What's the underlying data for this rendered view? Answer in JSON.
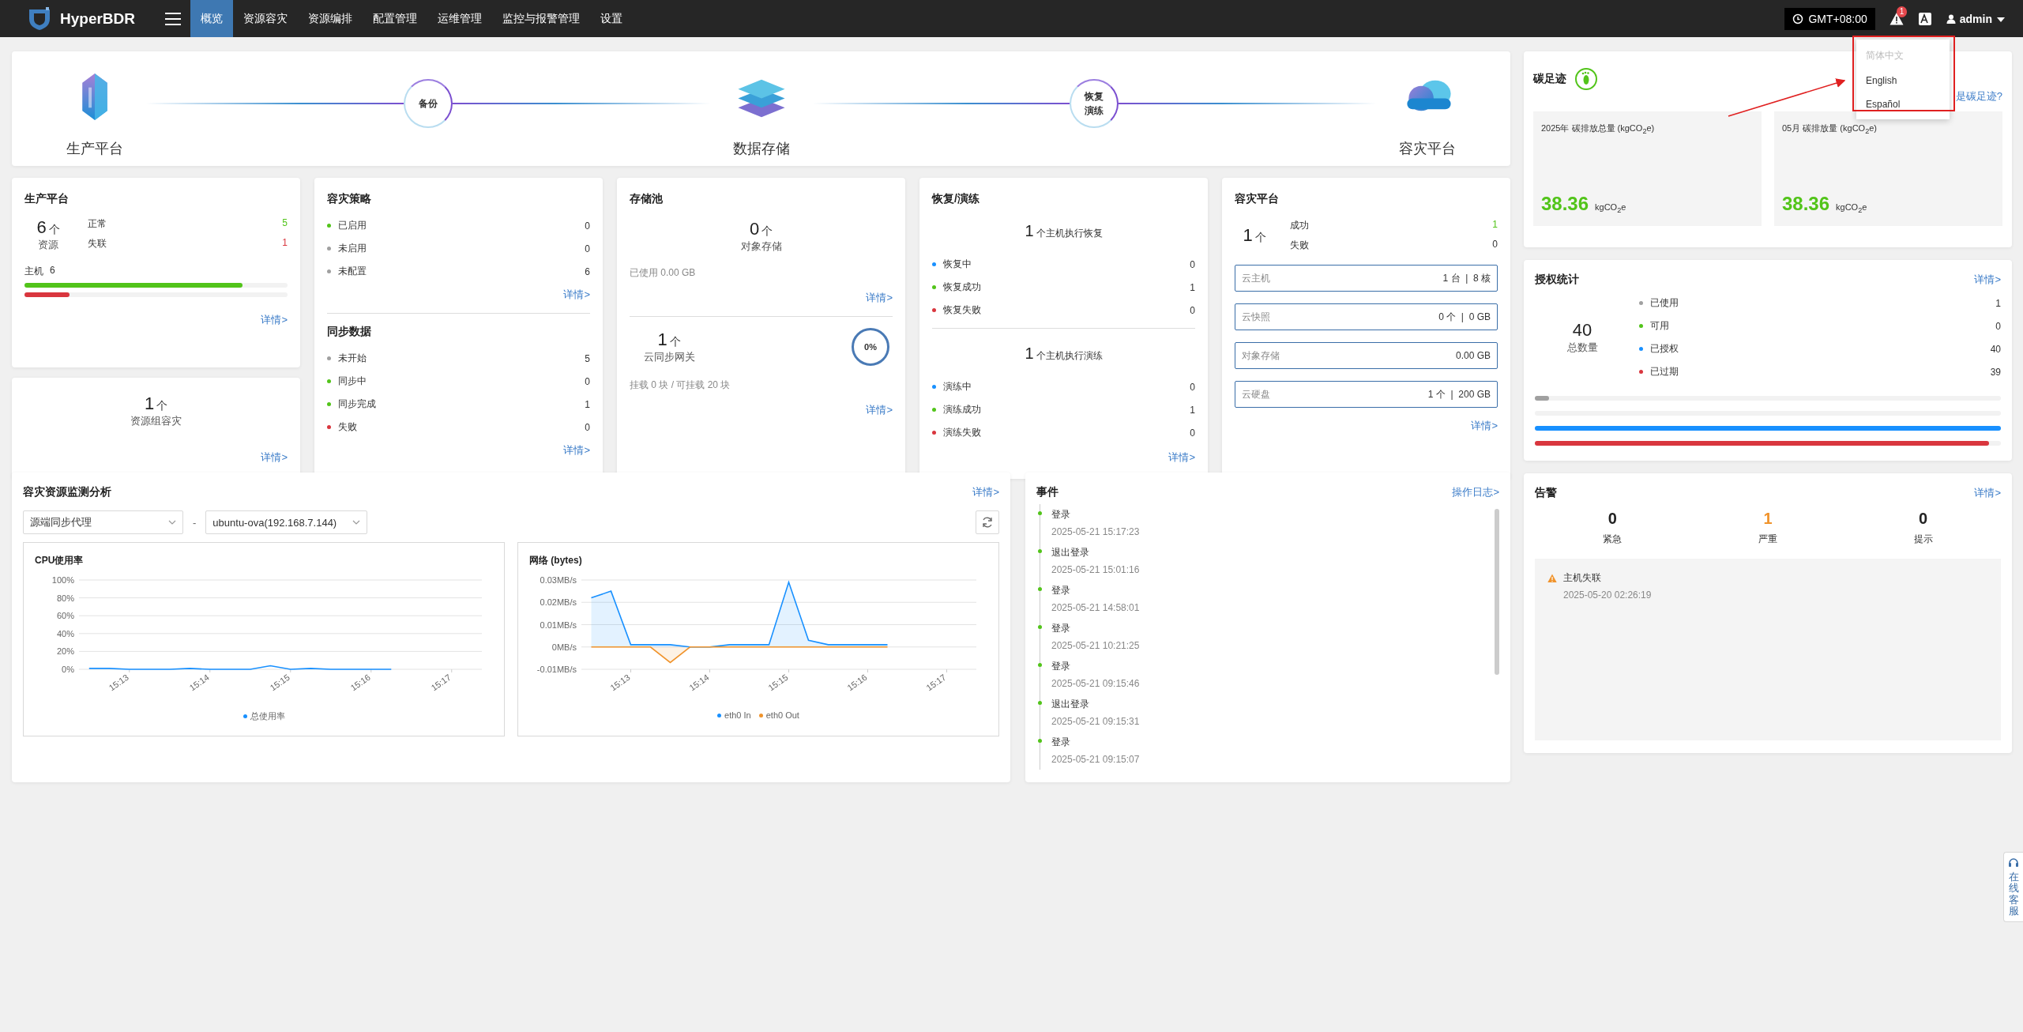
{
  "top_bar": {
    "brand": "HyperBDR",
    "nav": [
      {
        "label": "概览",
        "selected": true
      },
      {
        "label": "资源容灾",
        "selected": false
      },
      {
        "label": "资源编排",
        "selected": false
      },
      {
        "label": "配置管理",
        "selected": false
      },
      {
        "label": "运维管理",
        "selected": false
      },
      {
        "label": "监控与报警管理",
        "selected": false
      },
      {
        "label": "设置",
        "selected": false
      }
    ],
    "timezone": "GMT+08:00",
    "alert_count": "1",
    "user": "admin",
    "language_menu": [
      {
        "label": "简体中文",
        "disabled": true
      },
      {
        "label": "English",
        "disabled": false
      },
      {
        "label": "Español",
        "disabled": false
      }
    ]
  },
  "flow": {
    "stages": [
      {
        "kind": "production",
        "label": "生产平台"
      },
      {
        "kind": "storage",
        "label": "数据存储"
      },
      {
        "kind": "dr",
        "label": "容灾平台"
      }
    ],
    "steps": [
      {
        "lines": [
          "备份"
        ]
      },
      {
        "lines": [
          "恢复",
          "演练"
        ]
      }
    ]
  },
  "production_card": {
    "title": "生产平台",
    "total": "6",
    "unit": "个",
    "total_label": "资源",
    "stats": [
      {
        "label": "正常",
        "value": "5",
        "color": "#52c41a"
      },
      {
        "label": "失联",
        "value": "1",
        "color": "#d9363e"
      }
    ],
    "host_label": "主机",
    "host_count": "6",
    "bars": [
      {
        "level": 0.83,
        "color": "#52c41a"
      },
      {
        "level": 0.17,
        "color": "#d9363e"
      }
    ],
    "link": "详情>"
  },
  "group_card": {
    "count": "1",
    "unit": "个",
    "label": "资源组容灾",
    "link": "详情>"
  },
  "policy_card": {
    "sections": [
      {
        "title": "容灾策略",
        "items": [
          {
            "label": "已启用",
            "value": "0",
            "color": "#52c41a"
          },
          {
            "label": "未启用",
            "value": "0",
            "color": "#a0a0a0"
          },
          {
            "label": "未配置",
            "value": "6",
            "color": "#a0a0a0"
          }
        ],
        "link": "详情>"
      },
      {
        "title": "同步数据",
        "items": [
          {
            "label": "未开始",
            "value": "5",
            "color": "#a0a0a0"
          },
          {
            "label": "同步中",
            "value": "0",
            "color": "#52c41a"
          },
          {
            "label": "同步完成",
            "value": "1",
            "color": "#52c41a"
          },
          {
            "label": "失败",
            "value": "0",
            "color": "#d9363e"
          }
        ],
        "link": "详情>"
      }
    ]
  },
  "storage_card": {
    "title": "存储池",
    "object_count": "0",
    "unit": "个",
    "object_label": "对象存储",
    "used": "已使用 0.00 GB",
    "link": "详情>",
    "gateway_count": "1",
    "gateway_unit": "个",
    "gateway_label": "云同步网关",
    "percent": "0%",
    "mount": "挂载 0 块 / 可挂载 20 块",
    "gateway_link": "详情>"
  },
  "recovery_card": {
    "title": "恢复/演练",
    "sections": [
      {
        "count": "1",
        "caption": "个主机执行恢复",
        "items": [
          {
            "label": "恢复中",
            "value": "0",
            "color": "#1890ff"
          },
          {
            "label": "恢复成功",
            "value": "1",
            "color": "#52c41a"
          },
          {
            "label": "恢复失败",
            "value": "0",
            "color": "#d9363e"
          }
        ]
      },
      {
        "count": "1",
        "caption": "个主机执行演练",
        "items": [
          {
            "label": "演练中",
            "value": "0",
            "color": "#1890ff"
          },
          {
            "label": "演练成功",
            "value": "1",
            "color": "#52c41a"
          },
          {
            "label": "演练失败",
            "value": "0",
            "color": "#d9363e"
          }
        ]
      }
    ],
    "link": "详情>"
  },
  "dr_card": {
    "title": "容灾平台",
    "count": "1",
    "unit": "个",
    "stats": [
      {
        "label": "成功",
        "value": "1",
        "color": "#52c41a"
      },
      {
        "label": "失败",
        "value": "0"
      }
    ],
    "resources": [
      {
        "label": "云主机",
        "value": "1 台  |  8 核"
      },
      {
        "label": "云快照",
        "value": "0 个  |  0 GB"
      },
      {
        "label": "对象存储",
        "value": "0.00 GB"
      },
      {
        "label": "云硬盘",
        "value": "1 个  |  200 GB"
      }
    ],
    "link": "详情>"
  },
  "carbon_card": {
    "title": "碳足迹",
    "link": "是碳足迹?",
    "tiles": [
      {
        "label": "2025年 碳排放总量 (kgCO$_{2}$e)",
        "value": "38.36",
        "unit": "kgCO$_{2}$e"
      },
      {
        "label": "05月 碳排放量 (kgCO$_{2}$e)",
        "value": "38.36",
        "unit": "kgCO$_{2}$e"
      }
    ]
  },
  "license_card": {
    "title": "授权统计",
    "link": "详情>",
    "total": "40",
    "total_label": "总数量",
    "items": [
      {
        "label": "已使用",
        "value": "1",
        "color": "#a0a0a0",
        "level": 0.03
      },
      {
        "label": "可用",
        "value": "0",
        "color": "#52c41a",
        "level": 0
      },
      {
        "label": "已授权",
        "value": "40",
        "color": "#1890ff",
        "level": 1
      },
      {
        "label": "已过期",
        "value": "39",
        "color": "#d9363e",
        "level": 0.975
      }
    ]
  },
  "monitor_card": {
    "title": "容灾资源监测分析",
    "link": "详情>",
    "selects": [
      {
        "value": "源端同步代理"
      },
      {
        "value": "ubuntu-ova(192.168.7.144)"
      }
    ],
    "separator": "-",
    "charts": [
      {
        "title": "CPU使用率",
        "chart_data": {
          "type": "line",
          "categories": [
            null,
            null,
            "15:13",
            null,
            null,
            null,
            "15:14",
            null,
            null,
            null,
            "15:15",
            null,
            null,
            null,
            "15:16",
            null,
            null,
            null,
            "15:17",
            null
          ],
          "series": [
            {
              "name": "总使用率",
              "color": "#1890ff",
              "values": [
                1,
                1,
                0,
                0,
                0,
                1,
                0,
                0,
                0,
                4,
                0,
                1,
                0,
                0,
                0,
                0,
                null,
                null,
                null,
                null
              ]
            }
          ],
          "ylim": [
            0,
            100
          ],
          "grid": true,
          "yticks": [
            {
              "value": 0,
              "label": "0%"
            },
            {
              "value": 20,
              "label": "20%"
            },
            {
              "value": 40,
              "label": "40%"
            },
            {
              "value": 60,
              "label": "60%"
            },
            {
              "value": 80,
              "label": "80%"
            },
            {
              "value": 100,
              "label": "100%"
            }
          ]
        }
      },
      {
        "title": "网络 (bytes)",
        "chart_data": {
          "type": "area",
          "categories": [
            null,
            null,
            "15:13",
            null,
            null,
            null,
            "15:14",
            null,
            null,
            null,
            "15:15",
            null,
            null,
            null,
            "15:16",
            null,
            null,
            null,
            "15:17",
            null
          ],
          "series": [
            {
              "name": "eth0 In",
              "color": "#1890ff",
              "values": [
                0.022,
                0.025,
                0.001,
                0.001,
                0.001,
                0,
                0,
                0.001,
                0.001,
                0.001,
                0.029,
                0.003,
                0.001,
                0.001,
                0.001,
                0.001,
                null,
                null,
                null,
                null
              ]
            },
            {
              "name": "eth0 Out",
              "color": "#f0932b",
              "values": [
                0,
                0,
                0,
                0,
                -0.007,
                0,
                0,
                0,
                0,
                0,
                0,
                0,
                0,
                0,
                0,
                0,
                null,
                null,
                null,
                null
              ]
            }
          ],
          "ylim": [
            -0.01,
            0.03
          ],
          "grid": true,
          "yticks": [
            {
              "value": -0.01,
              "label": "-0.01MB/s"
            },
            {
              "value": 0,
              "label": "0MB/s"
            },
            {
              "value": 0.01,
              "label": "0.01MB/s"
            },
            {
              "value": 0.02,
              "label": "0.02MB/s"
            },
            {
              "value": 0.03,
              "label": "0.03MB/s"
            }
          ]
        }
      }
    ]
  },
  "events_card": {
    "title": "事件",
    "link": "操作日志>",
    "events": [
      {
        "name": "登录",
        "time": "2025-05-21 15:17:23"
      },
      {
        "name": "退出登录",
        "time": "2025-05-21 15:01:16"
      },
      {
        "name": "登录",
        "time": "2025-05-21 14:58:01"
      },
      {
        "name": "登录",
        "time": "2025-05-21 10:21:25"
      },
      {
        "name": "登录",
        "time": "2025-05-21 09:15:46"
      },
      {
        "name": "退出登录",
        "time": "2025-05-21 09:15:31"
      },
      {
        "name": "登录",
        "time": "2025-05-21 09:15:07"
      }
    ]
  },
  "alerts_card": {
    "title": "告警",
    "link": "详情>",
    "counts": [
      {
        "value": "0",
        "label": "紧急",
        "color": "#222222"
      },
      {
        "value": "1",
        "label": "严重",
        "color": "#f0932b"
      },
      {
        "value": "0",
        "label": "提示",
        "color": "#222222"
      }
    ],
    "alerts": [
      {
        "title": "主机失联",
        "time": "2025-05-20 02:26:19"
      }
    ]
  },
  "support_tab": {
    "label": "在线客服"
  }
}
